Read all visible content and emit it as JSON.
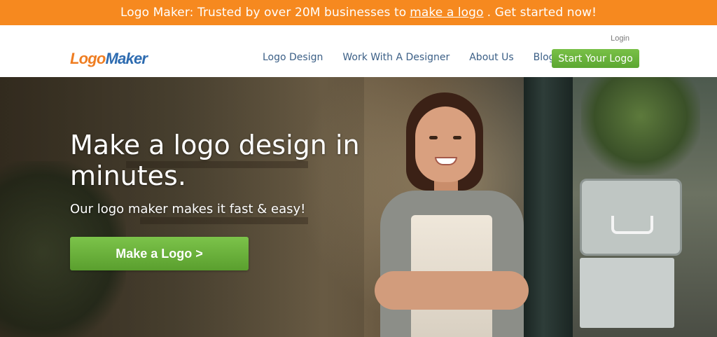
{
  "promo": {
    "prefix": "Logo Maker: Trusted by over 20M businesses to",
    "link": "make a logo",
    "suffix": ". Get started now!",
    "bg_color": "#f6891f"
  },
  "header": {
    "login": "Login",
    "logo_part1": "Logo",
    "logo_part2": "Maker",
    "nav": [
      "Logo Design",
      "Work With A Designer",
      "About Us",
      "Blog"
    ],
    "cta": "Start Your Logo"
  },
  "hero": {
    "title": "Make a logo design in minutes.",
    "subtitle": "Our logo maker makes it fast & easy!",
    "button": "Make a Logo >"
  },
  "colors": {
    "accent_orange": "#f6891f",
    "brand_blue": "#2d6bb0",
    "button_green": "#6cb43c"
  }
}
